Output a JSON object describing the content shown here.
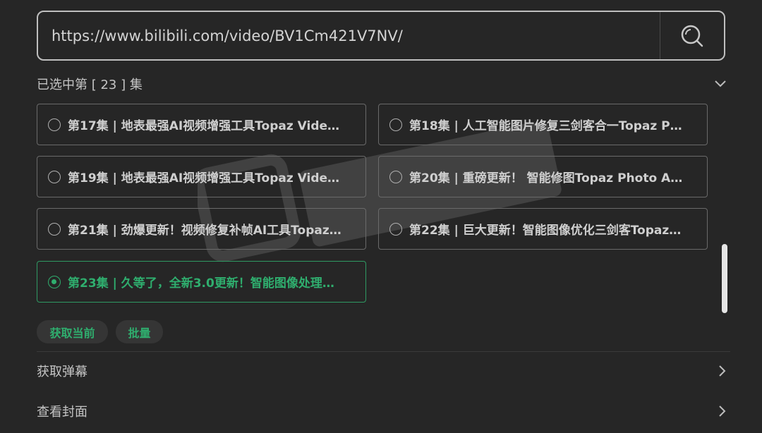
{
  "url_bar": {
    "value": "https://www.bilibili.com/video/BV1Cm421V7NV/"
  },
  "selection": {
    "text": "已选中第 [ 23 ] 集"
  },
  "episodes": [
    {
      "label": "第17集 | 地表最强AI视频增强工具Topaz Video…",
      "selected": false
    },
    {
      "label": "第18集 | 人工智能图片修复三剑客合一Topaz P…",
      "selected": false
    },
    {
      "label": "第19集 | 地表最强AI视频增强工具Topaz Video…",
      "selected": false
    },
    {
      "label": "第20集 | 重磅更新！ 智能修图Topaz Photo AI …",
      "selected": false
    },
    {
      "label": "第21集 | 劲爆更新！视频修复补帧AI工具Topaz…",
      "selected": false
    },
    {
      "label": "第22集 | 巨大更新！智能图像优化三剑客Topaz…",
      "selected": false
    },
    {
      "label": "第23集 | 久等了，全新3.0更新！智能图像处理…",
      "selected": true
    }
  ],
  "actions": {
    "get_current": "获取当前",
    "batch": "批量"
  },
  "menu": {
    "danmaku": "获取弹幕",
    "cover": "查看封面"
  },
  "colors": {
    "background": "#262626",
    "accent": "#2fae6e",
    "border": "#6a6a6a"
  },
  "icons": {
    "search": "search-icon",
    "collapse": "chevron-down-icon",
    "more": "chevron-right-icon"
  }
}
